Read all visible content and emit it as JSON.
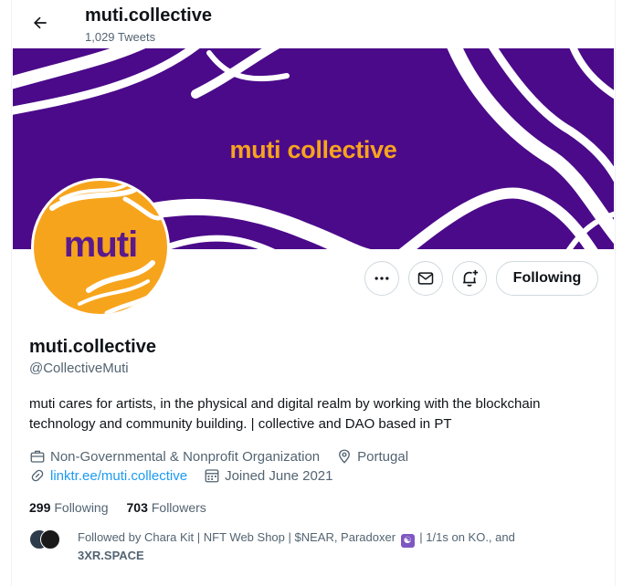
{
  "header": {
    "title": "muti.collective",
    "tweets_count": "1,029 Tweets"
  },
  "banner": {
    "text": "muti collective",
    "colors": {
      "background": "#4b0a8a",
      "text": "#f7a41d",
      "waves": "#ffffff"
    }
  },
  "avatar": {
    "text": "muti",
    "colors": {
      "background": "#f7a41d",
      "text": "#5a1a8c"
    }
  },
  "actions": {
    "more_icon": "more-horizontal-icon",
    "message_icon": "envelope-icon",
    "notify_icon": "bell-plus-icon",
    "following_label": "Following"
  },
  "profile": {
    "name": "muti.collective",
    "handle": "@CollectiveMuti",
    "bio": "muti cares for artists, in the physical and digital realm by working with the blockchain technology and community building. | collective and DAO based in PT",
    "category": "Non-Governmental & Nonprofit Organization",
    "location": "Portugal",
    "website": "linktr.ee/muti.collective",
    "joined": "Joined June 2021"
  },
  "stats": {
    "following_count": "299",
    "following_label": "Following",
    "followers_count": "703",
    "followers_label": "Followers"
  },
  "followed_by": {
    "prefix": "Followed by Chara Kit | NFT Web Shop | $NEAR, Paradoxer",
    "badge": "☯",
    "middle": "| 1/1s on KO., and",
    "last": "3XR.SPACE"
  },
  "colors": {
    "accent": "#1d9bf0",
    "secondary_text": "#536471",
    "border": "#cfd9de"
  }
}
